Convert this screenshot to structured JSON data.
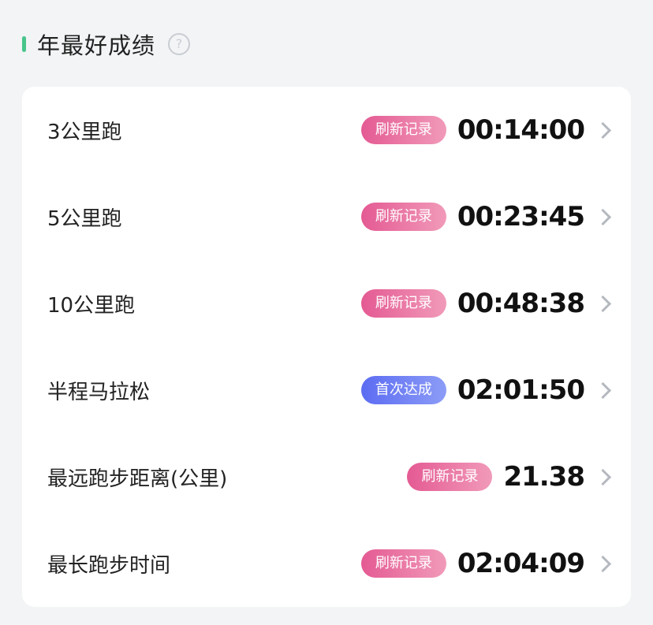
{
  "header": {
    "title": "年最好成绩",
    "help_icon": "help-circle-icon",
    "accent_color": "#47c58a"
  },
  "records": [
    {
      "label": "3公里跑",
      "badge": "刷新记录",
      "badge_type": "pink",
      "value": "00:14:00"
    },
    {
      "label": "5公里跑",
      "badge": "刷新记录",
      "badge_type": "pink",
      "value": "00:23:45"
    },
    {
      "label": "10公里跑",
      "badge": "刷新记录",
      "badge_type": "pink",
      "value": "00:48:38"
    },
    {
      "label": "半程马拉松",
      "badge": "首次达成",
      "badge_type": "blue",
      "value": "02:01:50"
    },
    {
      "label": "最远跑步距离(公里)",
      "badge": "刷新记录",
      "badge_type": "pink",
      "value": "21.38"
    },
    {
      "label": "最长跑步时间",
      "badge": "刷新记录",
      "badge_type": "pink",
      "value": "02:04:09"
    }
  ],
  "colors": {
    "badge_pink": "#e45a93",
    "badge_blue": "#5c6cf2"
  }
}
